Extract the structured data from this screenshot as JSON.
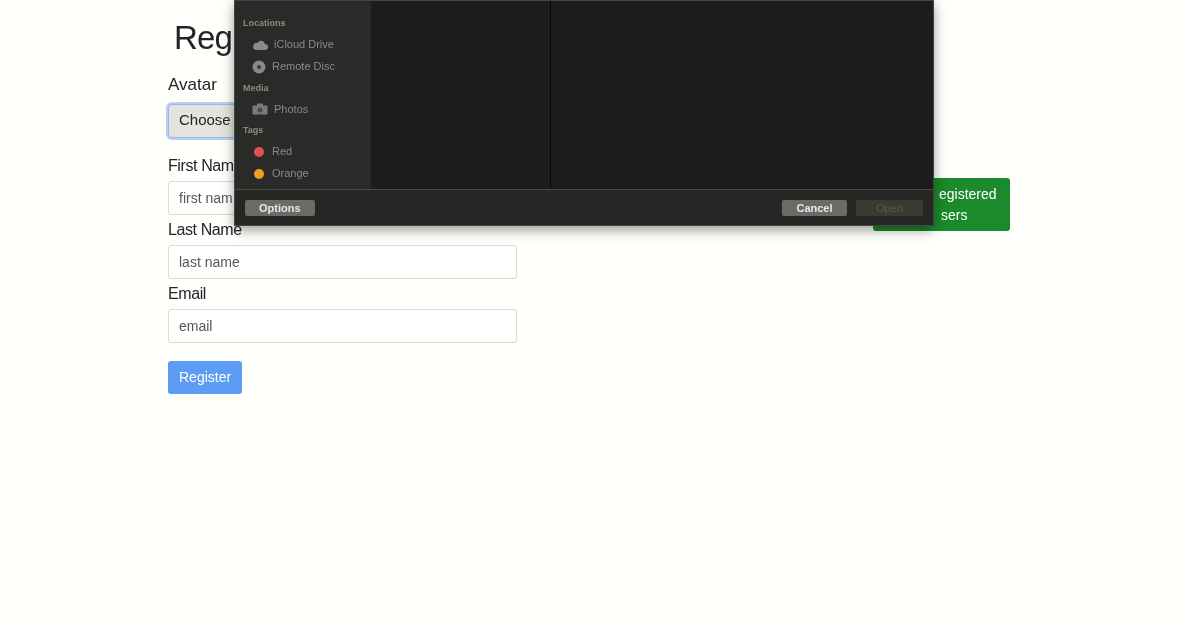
{
  "page": {
    "title": "Reg"
  },
  "form": {
    "avatar_label": "Avatar",
    "file_button": "Choose",
    "fields": [
      {
        "label": "First Nam",
        "placeholder": "first nam"
      },
      {
        "label": "Last Name",
        "placeholder": "last name"
      },
      {
        "label": "Email",
        "placeholder": "email"
      }
    ],
    "submit": "Register"
  },
  "users_button": {
    "lines": [
      "egistered",
      "sers"
    ]
  },
  "file_dialog": {
    "sidebar": [
      {
        "heading": "Locations",
        "items": [
          {
            "label": "iCloud Drive",
            "kind": "cloud"
          },
          {
            "label": "Remote Disc",
            "kind": "disc"
          }
        ]
      },
      {
        "heading": "Media",
        "items": [
          {
            "label": "Photos",
            "kind": "camera"
          }
        ]
      },
      {
        "heading": "Tags",
        "items": [
          {
            "label": "Red",
            "kind": "tag",
            "color": "#e05252"
          },
          {
            "label": "Orange",
            "kind": "tag",
            "color": "#f0a020"
          }
        ]
      }
    ],
    "options_button": "Options",
    "cancel_button": "Cancel",
    "open_button": {
      "label": "Open",
      "disabled": true
    }
  }
}
